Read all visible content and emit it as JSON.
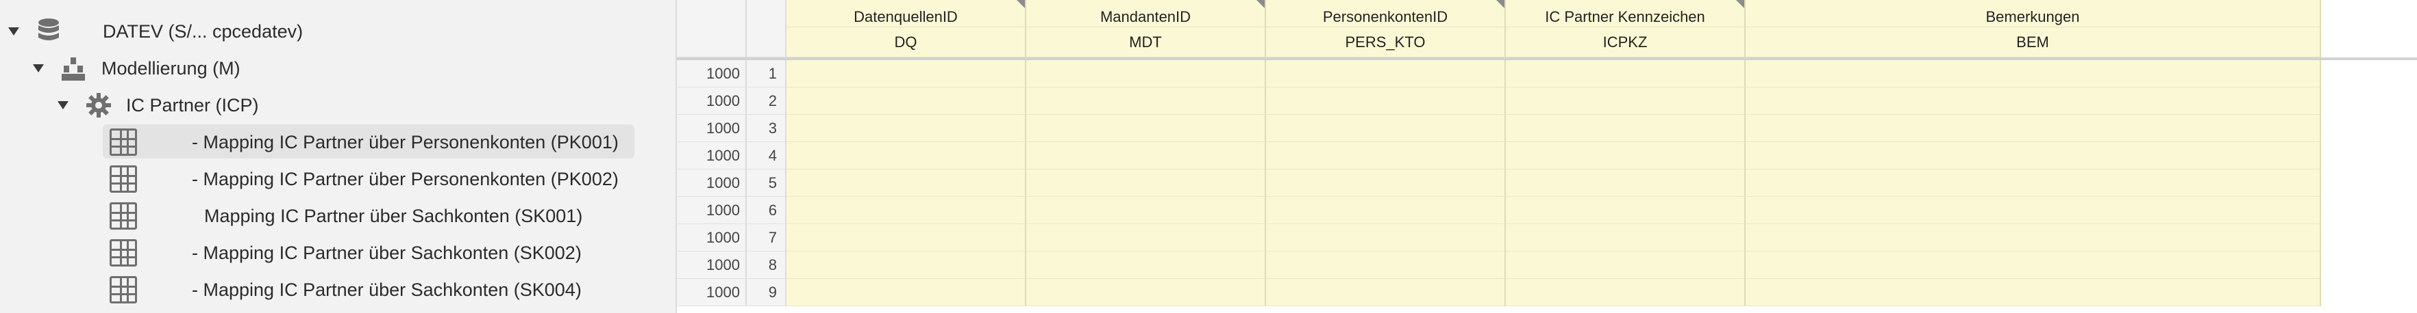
{
  "tree": {
    "root": {
      "label": "DATEV (S/... cpcedatev)",
      "icon": "database-icon"
    },
    "model": {
      "label": "Modellierung (M)",
      "icon": "org-chart-icon"
    },
    "icp": {
      "label": "IC Partner (ICP)",
      "icon": "gear-icon"
    },
    "tables": [
      {
        "label": "- Mapping IC Partner über Personenkonten (PK001)",
        "selected": true
      },
      {
        "label": "- Mapping IC Partner über Personenkonten (PK002)",
        "selected": false
      },
      {
        "label": "Mapping IC Partner über Sachkonten (SK001)",
        "selected": false
      },
      {
        "label": "- Mapping IC Partner über Sachkonten (SK002)",
        "selected": false
      },
      {
        "label": "- Mapping IC Partner über Sachkonten (SK004)",
        "selected": false
      }
    ]
  },
  "grid": {
    "columns": [
      {
        "title": "DatenquellenID",
        "code": "DQ"
      },
      {
        "title": "MandantenID",
        "code": "MDT"
      },
      {
        "title": "PersonenkontenID",
        "code": "PERS_KTO"
      },
      {
        "title": "IC Partner Kennzeichen",
        "code": "ICPKZ"
      },
      {
        "title": "Bemerkungen",
        "code": "BEM"
      }
    ],
    "rows": [
      {
        "value": "1000",
        "index": "1"
      },
      {
        "value": "1000",
        "index": "2"
      },
      {
        "value": "1000",
        "index": "3"
      },
      {
        "value": "1000",
        "index": "4"
      },
      {
        "value": "1000",
        "index": "5"
      },
      {
        "value": "1000",
        "index": "6"
      },
      {
        "value": "1000",
        "index": "7"
      },
      {
        "value": "1000",
        "index": "8"
      },
      {
        "value": "1000",
        "index": "9"
      }
    ]
  }
}
